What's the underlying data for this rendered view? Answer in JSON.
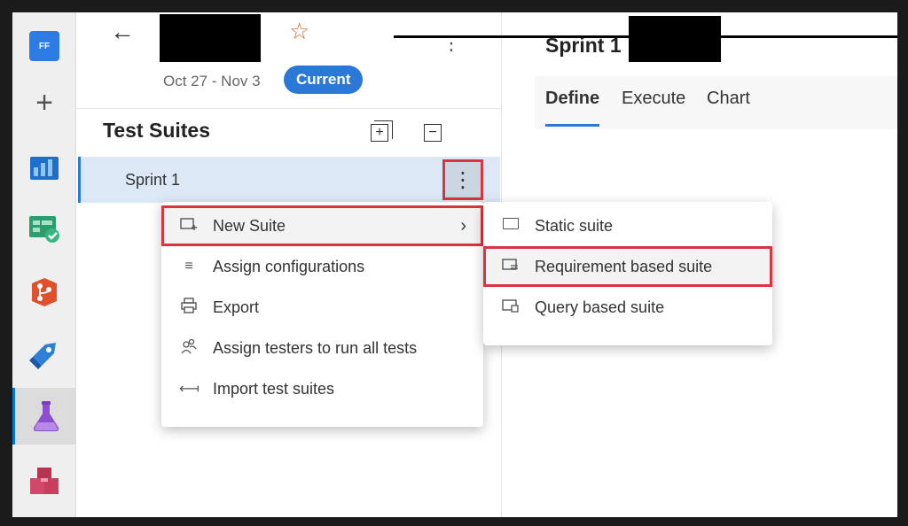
{
  "rail": {
    "org_badge": "FF",
    "items": [
      {
        "icon": "org-badge-icon"
      },
      {
        "icon": "plus-icon"
      },
      {
        "icon": "boards-icon"
      },
      {
        "icon": "test-plans-check-icon"
      },
      {
        "icon": "repos-icon"
      },
      {
        "icon": "pipelines-icon"
      },
      {
        "icon": "test-flask-icon",
        "active": true
      },
      {
        "icon": "artifacts-icon"
      }
    ]
  },
  "header": {
    "back": "←",
    "star": "☆",
    "more": "⋮",
    "dates": "Oct 27 - Nov 3",
    "current_badge": "Current"
  },
  "test_suites": {
    "title": "Test Suites",
    "expand_icon": "+",
    "collapse_icon": "−",
    "rows": [
      {
        "label": "Sprint 1",
        "more": "⋮"
      }
    ]
  },
  "right_panel": {
    "title": "Sprint 1",
    "tabs": [
      {
        "label": "Define",
        "active": true
      },
      {
        "label": "Execute"
      },
      {
        "label": "Chart"
      }
    ]
  },
  "context_menu": {
    "items": [
      {
        "label": "New Suite",
        "icon": "new-suite-icon",
        "chevron": "›",
        "highlighted": true
      },
      {
        "label": "Assign configurations",
        "icon": "list-icon"
      },
      {
        "label": "Export",
        "icon": "printer-icon"
      },
      {
        "label": "Assign testers to run all tests",
        "icon": "people-icon"
      },
      {
        "label": "Import test suites",
        "icon": "import-arrow-icon"
      }
    ]
  },
  "submenu": {
    "items": [
      {
        "label": "Static suite",
        "icon": "folder-icon"
      },
      {
        "label": "Requirement based suite",
        "icon": "requirement-folder-icon",
        "highlighted": true
      },
      {
        "label": "Query based suite",
        "icon": "query-folder-icon"
      }
    ]
  },
  "colors": {
    "accent": "#2b78d6",
    "highlight_border": "#d9343f",
    "star": "#d66b2a"
  }
}
